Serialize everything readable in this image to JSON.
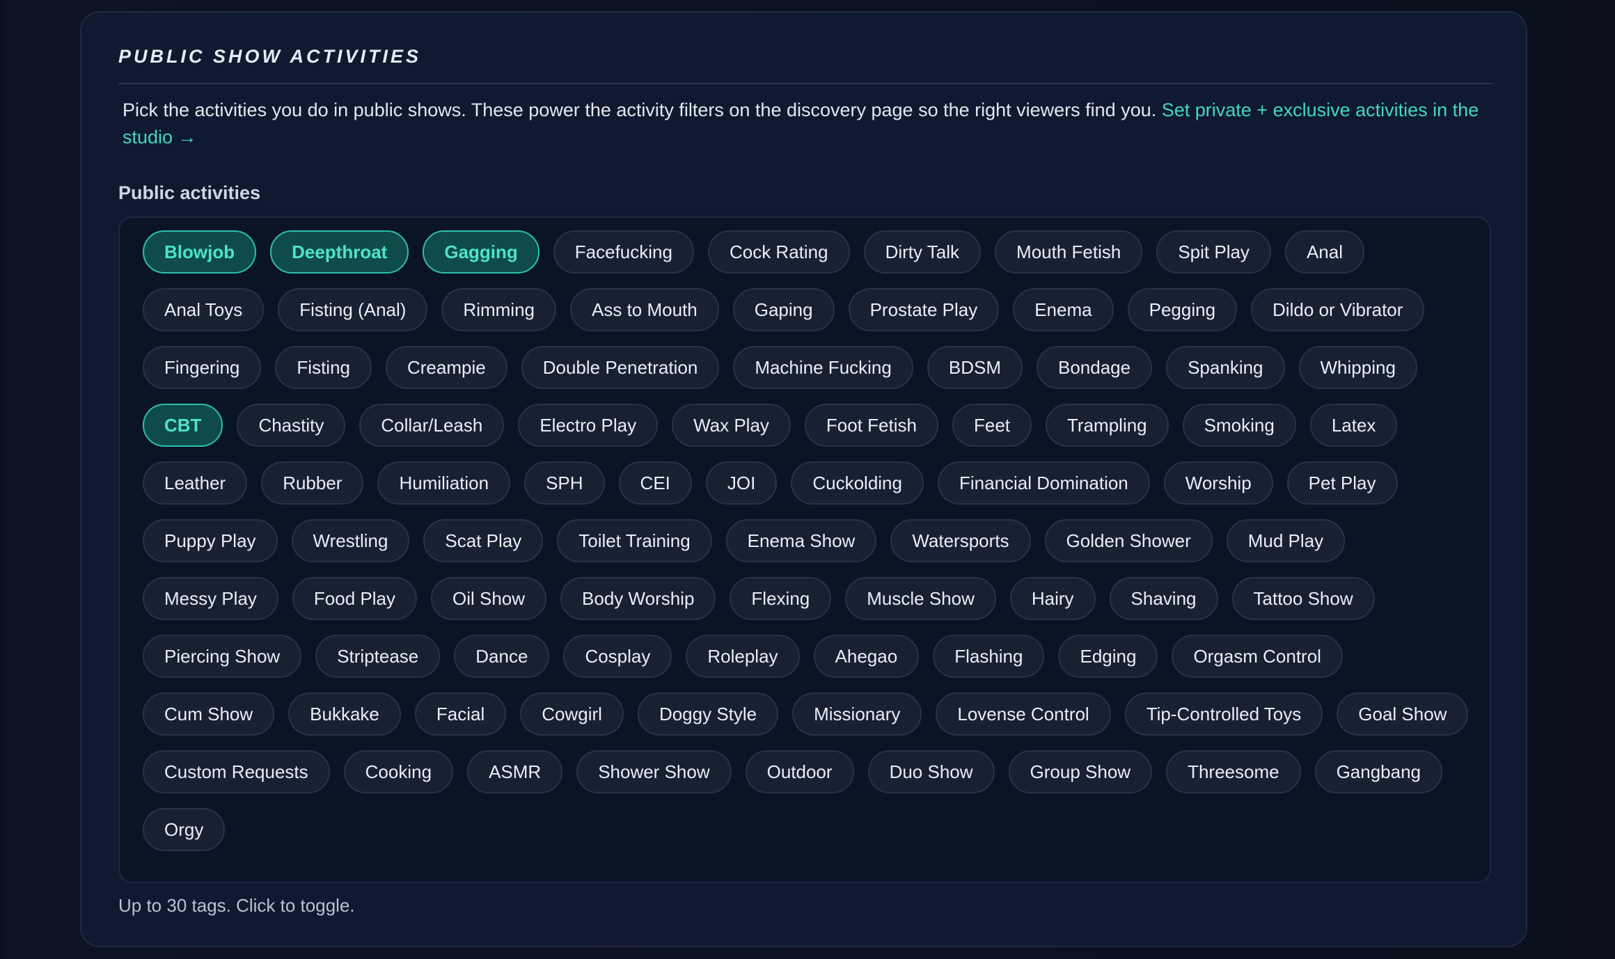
{
  "section": {
    "title": "PUBLIC SHOW ACTIVITIES",
    "description": "Pick the activities you do in public shows. These power the activity filters on the discovery page so the right viewers find you. ",
    "studio_link": "Set private + exclusive activities in the studio →",
    "field_label": "Public activities",
    "hint": "Up to 30 tags. Click to toggle."
  },
  "accent_color": "#43d6c3",
  "tag_rows": [
    [
      {
        "label": "Blowjob",
        "selected": true
      },
      {
        "label": "Deepthroat",
        "selected": true
      },
      {
        "label": "Gagging",
        "selected": true
      },
      {
        "label": "Facefucking",
        "selected": false
      },
      {
        "label": "Cock Rating",
        "selected": false
      },
      {
        "label": "Dirty Talk",
        "selected": false
      },
      {
        "label": "Mouth Fetish",
        "selected": false
      },
      {
        "label": "Spit Play",
        "selected": false
      },
      {
        "label": "Anal",
        "selected": false
      }
    ],
    [
      {
        "label": "Anal Toys",
        "selected": false
      },
      {
        "label": "Fisting (Anal)",
        "selected": false
      },
      {
        "label": "Rimming",
        "selected": false
      },
      {
        "label": "Ass to Mouth",
        "selected": false
      },
      {
        "label": "Gaping",
        "selected": false
      },
      {
        "label": "Prostate Play",
        "selected": false
      },
      {
        "label": "Enema",
        "selected": false
      },
      {
        "label": "Pegging",
        "selected": false
      },
      {
        "label": "Dildo or Vibrator",
        "selected": false
      }
    ],
    [
      {
        "label": "Fingering",
        "selected": false
      },
      {
        "label": "Fisting",
        "selected": false
      },
      {
        "label": "Creampie",
        "selected": false
      },
      {
        "label": "Double Penetration",
        "selected": false
      },
      {
        "label": "Machine Fucking",
        "selected": false
      },
      {
        "label": "BDSM",
        "selected": false
      },
      {
        "label": "Bondage",
        "selected": false
      },
      {
        "label": "Spanking",
        "selected": false
      },
      {
        "label": "Whipping",
        "selected": false
      }
    ],
    [
      {
        "label": "CBT",
        "selected": true
      },
      {
        "label": "Chastity",
        "selected": false
      },
      {
        "label": "Collar/Leash",
        "selected": false
      },
      {
        "label": "Electro Play",
        "selected": false
      },
      {
        "label": "Wax Play",
        "selected": false
      },
      {
        "label": "Foot Fetish",
        "selected": false
      },
      {
        "label": "Feet",
        "selected": false
      },
      {
        "label": "Trampling",
        "selected": false
      },
      {
        "label": "Smoking",
        "selected": false
      },
      {
        "label": "Latex",
        "selected": false
      }
    ],
    [
      {
        "label": "Leather",
        "selected": false
      },
      {
        "label": "Rubber",
        "selected": false
      },
      {
        "label": "Humiliation",
        "selected": false
      },
      {
        "label": "SPH",
        "selected": false
      },
      {
        "label": "CEI",
        "selected": false
      },
      {
        "label": "JOI",
        "selected": false
      },
      {
        "label": "Cuckolding",
        "selected": false
      },
      {
        "label": "Financial Domination",
        "selected": false
      },
      {
        "label": "Worship",
        "selected": false
      },
      {
        "label": "Pet Play",
        "selected": false
      }
    ],
    [
      {
        "label": "Puppy Play",
        "selected": false
      },
      {
        "label": "Wrestling",
        "selected": false
      },
      {
        "label": "Scat Play",
        "selected": false
      },
      {
        "label": "Toilet Training",
        "selected": false
      },
      {
        "label": "Enema Show",
        "selected": false
      },
      {
        "label": "Watersports",
        "selected": false
      },
      {
        "label": "Golden Shower",
        "selected": false
      },
      {
        "label": "Mud Play",
        "selected": false
      }
    ],
    [
      {
        "label": "Messy Play",
        "selected": false
      },
      {
        "label": "Food Play",
        "selected": false
      },
      {
        "label": "Oil Show",
        "selected": false
      },
      {
        "label": "Body Worship",
        "selected": false
      },
      {
        "label": "Flexing",
        "selected": false
      },
      {
        "label": "Muscle Show",
        "selected": false
      },
      {
        "label": "Hairy",
        "selected": false
      },
      {
        "label": "Shaving",
        "selected": false
      },
      {
        "label": "Tattoo Show",
        "selected": false
      }
    ],
    [
      {
        "label": "Piercing Show",
        "selected": false
      },
      {
        "label": "Striptease",
        "selected": false
      },
      {
        "label": "Dance",
        "selected": false
      },
      {
        "label": "Cosplay",
        "selected": false
      },
      {
        "label": "Roleplay",
        "selected": false
      },
      {
        "label": "Ahegao",
        "selected": false
      },
      {
        "label": "Flashing",
        "selected": false
      },
      {
        "label": "Edging",
        "selected": false
      },
      {
        "label": "Orgasm Control",
        "selected": false
      }
    ],
    [
      {
        "label": "Cum Show",
        "selected": false
      },
      {
        "label": "Bukkake",
        "selected": false
      },
      {
        "label": "Facial",
        "selected": false
      },
      {
        "label": "Cowgirl",
        "selected": false
      },
      {
        "label": "Doggy Style",
        "selected": false
      },
      {
        "label": "Missionary",
        "selected": false
      },
      {
        "label": "Lovense Control",
        "selected": false
      },
      {
        "label": "Tip-Controlled Toys",
        "selected": false
      },
      {
        "label": "Goal Show",
        "selected": false
      }
    ],
    [
      {
        "label": "Custom Requests",
        "selected": false
      },
      {
        "label": "Cooking",
        "selected": false
      },
      {
        "label": "ASMR",
        "selected": false
      },
      {
        "label": "Shower Show",
        "selected": false
      },
      {
        "label": "Outdoor",
        "selected": false
      },
      {
        "label": "Duo Show",
        "selected": false
      },
      {
        "label": "Group Show",
        "selected": false
      },
      {
        "label": "Threesome",
        "selected": false
      },
      {
        "label": "Gangbang",
        "selected": false
      }
    ],
    [
      {
        "label": "Orgy",
        "selected": false
      }
    ]
  ]
}
